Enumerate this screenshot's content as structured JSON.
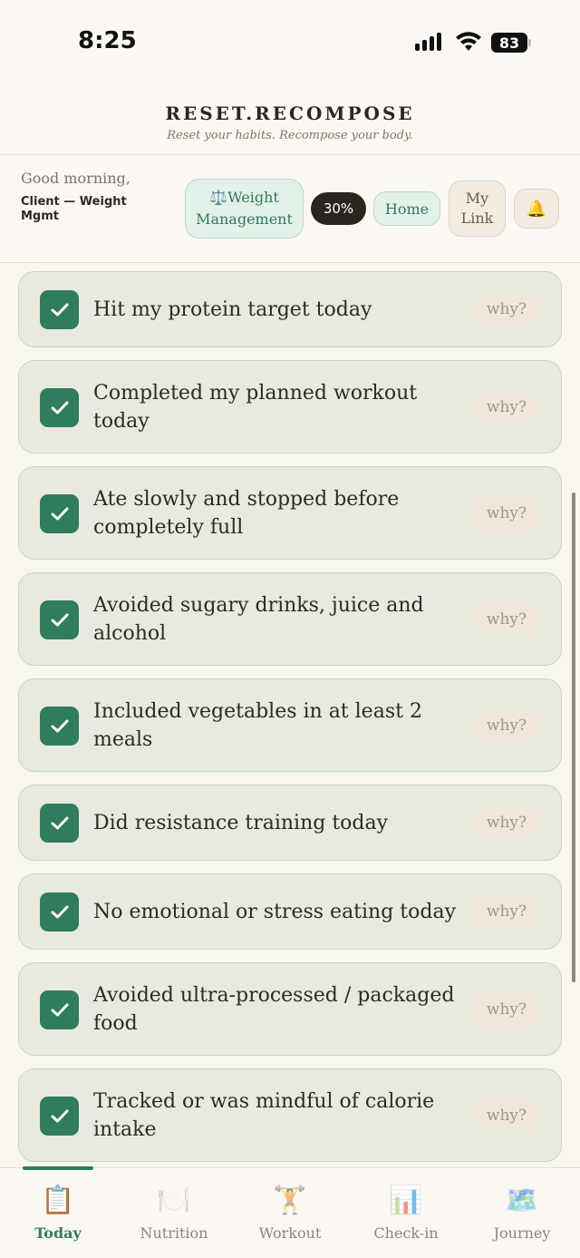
{
  "status_bar": {
    "time": "8:25",
    "battery": "83"
  },
  "brand": {
    "title": "RESET.RECOMPOSE",
    "tagline": "Reset your habits. Recompose your body."
  },
  "greeting": {
    "text": "Good morning,",
    "client": "Client — Weight Mgmt"
  },
  "chips": {
    "program_icon": "⚖️",
    "program_line1": "Weight",
    "program_line2": "Management",
    "progress": "30%",
    "home": "Home",
    "link_line1": "My",
    "link_line2": "Link",
    "bell": "🔔"
  },
  "habits": [
    {
      "text": "Hit my protein target today",
      "checked": true,
      "why": "why?"
    },
    {
      "text": "Completed my planned workout today",
      "checked": true,
      "why": "why?"
    },
    {
      "text": "Ate slowly and stopped before completely full",
      "checked": true,
      "why": "why?"
    },
    {
      "text": "Avoided sugary drinks, juice and alcohol",
      "checked": true,
      "why": "why?"
    },
    {
      "text": "Included vegetables in at least 2 meals",
      "checked": true,
      "why": "why?"
    },
    {
      "text": "Did resistance training today",
      "checked": true,
      "why": "why?"
    },
    {
      "text": "No emotional or stress eating today",
      "checked": true,
      "why": "why?"
    },
    {
      "text": "Avoided ultra-processed / packaged food",
      "checked": true,
      "why": "why?"
    },
    {
      "text": "Tracked or was mindful of calorie intake",
      "checked": true,
      "why": "why?"
    }
  ],
  "nav": [
    {
      "label": "Today",
      "icon": "📋",
      "active": true
    },
    {
      "label": "Nutrition",
      "icon": "🍽️",
      "active": false
    },
    {
      "label": "Workout",
      "icon": "🏋️",
      "active": false
    },
    {
      "label": "Check-in",
      "icon": "📊",
      "active": false
    },
    {
      "label": "Journey",
      "icon": "🗺️",
      "active": false
    }
  ]
}
